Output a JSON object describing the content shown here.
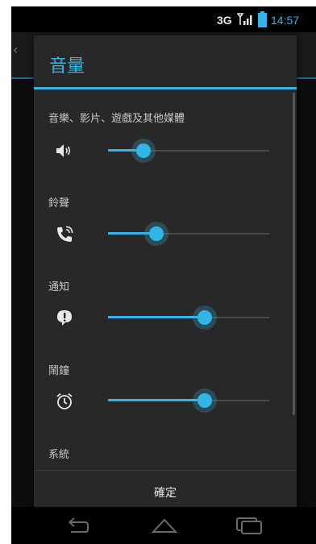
{
  "status_bar": {
    "network": "3G",
    "time": "14:57",
    "signal_icon": "signal-icon",
    "battery_icon": "battery-icon"
  },
  "dialog": {
    "title": "音量",
    "streams": [
      {
        "label": "音樂、影片、遊戲及其他媒體",
        "icon": "speaker-icon",
        "level": 0.22
      },
      {
        "label": "鈴聲",
        "icon": "ringer-icon",
        "level": 0.3
      },
      {
        "label": "通知",
        "icon": "notification-icon",
        "level": 0.6
      },
      {
        "label": "鬧鐘",
        "icon": "alarm-icon",
        "level": 0.6
      },
      {
        "label": "系統",
        "icon": "system-icon",
        "level": null
      }
    ],
    "ok_label": "確定"
  },
  "nav_bar": {
    "back_icon": "back-icon",
    "home_icon": "home-icon",
    "recents_icon": "recents-icon"
  },
  "colors": {
    "accent": "#33b5e5",
    "dialog_bg": "#282828",
    "screen_bg": "#0d0d0d"
  }
}
